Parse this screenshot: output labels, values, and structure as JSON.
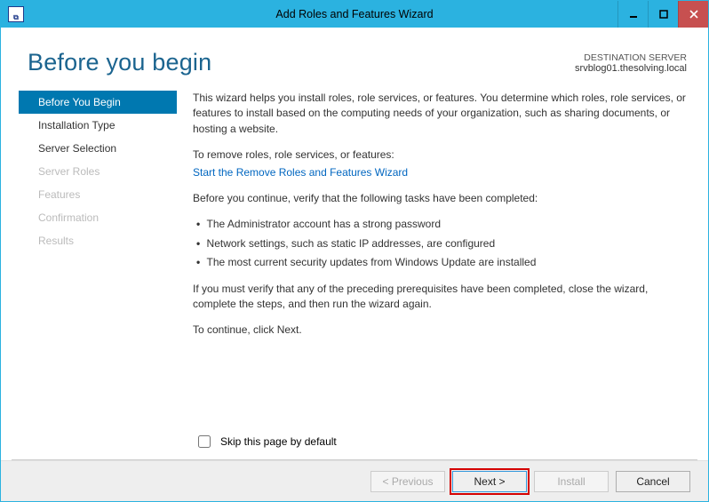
{
  "window": {
    "title": "Add Roles and Features Wizard"
  },
  "header": {
    "page_title": "Before you begin",
    "destination_label": "DESTINATION SERVER",
    "destination_name": "srvblog01.thesolving.local"
  },
  "sidebar": {
    "items": [
      {
        "label": "Before You Begin",
        "state": "active"
      },
      {
        "label": "Installation Type",
        "state": "enabled"
      },
      {
        "label": "Server Selection",
        "state": "enabled"
      },
      {
        "label": "Server Roles",
        "state": "disabled"
      },
      {
        "label": "Features",
        "state": "disabled"
      },
      {
        "label": "Confirmation",
        "state": "disabled"
      },
      {
        "label": "Results",
        "state": "disabled"
      }
    ]
  },
  "main": {
    "intro": "This wizard helps you install roles, role services, or features. You determine which roles, role services, or features to install based on the computing needs of your organization, such as sharing documents, or hosting a website.",
    "remove_heading": "To remove roles, role services, or features:",
    "remove_link": "Start the Remove Roles and Features Wizard",
    "verify_heading": "Before you continue, verify that the following tasks have been completed:",
    "bullets": [
      "The Administrator account has a strong password",
      "Network settings, such as static IP addresses, are configured",
      "The most current security updates from Windows Update are installed"
    ],
    "verify_note": "If you must verify that any of the preceding prerequisites have been completed, close the wizard, complete the steps, and then run the wizard again.",
    "continue_note": "To continue, click Next.",
    "skip_checkbox_label": "Skip this page by default"
  },
  "footer": {
    "previous": "< Previous",
    "next": "Next >",
    "install": "Install",
    "cancel": "Cancel"
  }
}
